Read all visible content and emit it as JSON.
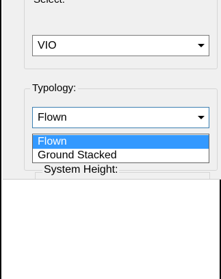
{
  "sections": {
    "top_group_label": "Select:",
    "typology_label": "Typology:",
    "system_height_label": "System Height:"
  },
  "combos": {
    "first": {
      "value": "VIO"
    },
    "typology": {
      "value": "Flown"
    }
  },
  "dropdown": {
    "options": [
      {
        "label": "Flown",
        "selected": true
      },
      {
        "label": "Ground Stacked",
        "selected": false
      }
    ]
  },
  "colors": {
    "selection": "#3399ff",
    "panel": "#f0f0f0"
  }
}
